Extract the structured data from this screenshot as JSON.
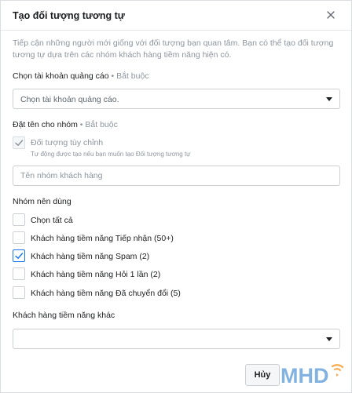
{
  "dialog": {
    "title": "Tạo đối tượng tương tự",
    "description": "Tiếp cận những người mới giống với đối tượng bạn quan tâm. Bạn có thể tạo đối tượng tương tự dựa trên các nhóm khách hàng tiềm năng hiện có."
  },
  "ad_account": {
    "label": "Chọn tài khoản quảng cáo",
    "required": " • Bắt buộc",
    "placeholder": "Chọn tài khoản quảng cáo."
  },
  "group_name": {
    "label": "Đặt tên cho nhóm",
    "required": " • Bắt buộc",
    "custom_label": "Đối tượng tùy chỉnh",
    "custom_sub": "Tự động được tạo nếu bạn muốn tạo Đối tượng tương tự",
    "placeholder": "Tên nhóm khách hàng",
    "value": ""
  },
  "suggested": {
    "label": "Nhóm nên dùng",
    "items": [
      {
        "label": "Chọn tất cả",
        "checked": false
      },
      {
        "label": "Khách hàng tiềm năng Tiếp nhận (50+)",
        "checked": false
      },
      {
        "label": "Khách hàng tiềm năng Spam (2)",
        "checked": true
      },
      {
        "label": "Khách hàng tiềm năng Hỏi 1 lần (2)",
        "checked": false
      },
      {
        "label": "Khách hàng tiềm năng Đã chuyển đổi (5)",
        "checked": false
      }
    ]
  },
  "other_leads": {
    "label": "Khách hàng tiềm năng khác",
    "value": ""
  },
  "footer": {
    "cancel_label": "Hủy"
  },
  "colors": {
    "check_blue": "#1877f2",
    "logo_blue": "#1a73c8",
    "logo_orange": "#f7931e"
  }
}
